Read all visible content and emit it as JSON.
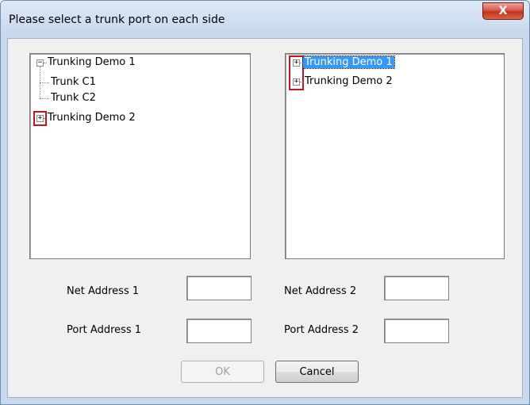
{
  "window": {
    "title": "Please select a trunk port on each side",
    "close_glyph": "X"
  },
  "left_tree": {
    "items": [
      {
        "label": "Trunking Demo 1",
        "expander": "−"
      },
      {
        "label": "Trunk C1"
      },
      {
        "label": "Trunk C2"
      },
      {
        "label": "Trunking Demo 2",
        "expander": "+"
      }
    ]
  },
  "right_tree": {
    "items": [
      {
        "label": "Trunking Demo 1",
        "expander": "+",
        "selected": true
      },
      {
        "label": "Trunking Demo 2",
        "expander": "+"
      }
    ]
  },
  "fields": {
    "net_address_1": {
      "label": "Net Address 1",
      "value": ""
    },
    "net_address_2": {
      "label": "Net Address 2",
      "value": ""
    },
    "port_address_1": {
      "label": "Port Address 1",
      "value": ""
    },
    "port_address_2": {
      "label": "Port Address 2",
      "value": ""
    }
  },
  "buttons": {
    "ok": "OK",
    "cancel": "Cancel"
  },
  "colors": {
    "selection": "#3399ff",
    "highlight_box": "#c0161c",
    "close_button": "#c2331f"
  }
}
